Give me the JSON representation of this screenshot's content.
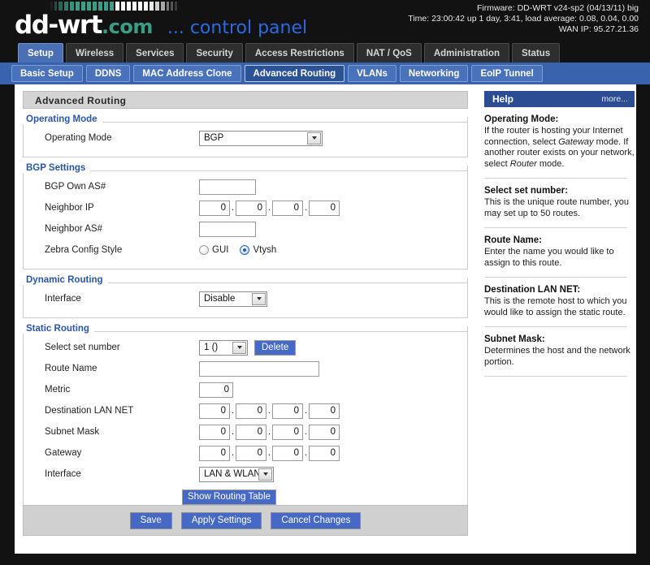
{
  "header": {
    "logo_main": "dd-wrt",
    "logo_suffix": ".com",
    "logo_tagline": "... control panel",
    "firmware": "Firmware: DD-WRT v24-sp2 (04/13/11) big",
    "time": "Time: 23:00:42 up 1 day, 3:41, load average: 0.08, 0.04, 0.00",
    "wan_ip": "WAN IP: 95.27.21.36"
  },
  "main_tabs": [
    {
      "label": "Setup",
      "active": true
    },
    {
      "label": "Wireless",
      "active": false
    },
    {
      "label": "Services",
      "active": false
    },
    {
      "label": "Security",
      "active": false
    },
    {
      "label": "Access Restrictions",
      "active": false
    },
    {
      "label": "NAT / QoS",
      "active": false
    },
    {
      "label": "Administration",
      "active": false
    },
    {
      "label": "Status",
      "active": false
    }
  ],
  "sub_tabs": [
    {
      "label": "Basic Setup",
      "active": false
    },
    {
      "label": "DDNS",
      "active": false
    },
    {
      "label": "MAC Address Clone",
      "active": false
    },
    {
      "label": "Advanced Routing",
      "active": true
    },
    {
      "label": "VLANs",
      "active": false
    },
    {
      "label": "Networking",
      "active": false
    },
    {
      "label": "EoIP Tunnel",
      "active": false
    }
  ],
  "page": {
    "title": "Advanced Routing"
  },
  "operating_mode": {
    "legend": "Operating Mode",
    "label": "Operating Mode",
    "value": "BGP"
  },
  "bgp_settings": {
    "legend": "BGP Settings",
    "own_as_label": "BGP Own AS#",
    "own_as_value": "",
    "neighbor_ip_label": "Neighbor IP",
    "neighbor_ip_octets": [
      "0",
      "0",
      "0",
      "0"
    ],
    "neighbor_as_label": "Neighbor AS#",
    "neighbor_as_value": "",
    "zebra_label": "Zebra Config Style",
    "zebra_options": [
      {
        "label": "GUI",
        "selected": false
      },
      {
        "label": "Vtysh",
        "selected": true
      }
    ]
  },
  "dynamic_routing": {
    "legend": "Dynamic Routing",
    "interface_label": "Interface",
    "interface_value": "Disable"
  },
  "static_routing": {
    "legend": "Static Routing",
    "set_number_label": "Select set number",
    "set_number_value": "1 ()",
    "delete_label": "Delete",
    "route_name_label": "Route Name",
    "route_name_value": "",
    "metric_label": "Metric",
    "metric_value": "0",
    "dest_lan_label": "Destination LAN NET",
    "dest_lan_octets": [
      "0",
      "0",
      "0",
      "0"
    ],
    "subnet_mask_label": "Subnet Mask",
    "subnet_mask_octets": [
      "0",
      "0",
      "0",
      "0"
    ],
    "gateway_label": "Gateway",
    "gateway_octets": [
      "0",
      "0",
      "0",
      "0"
    ],
    "interface_label": "Interface",
    "interface_value": "LAN & WLAN",
    "show_routing_table_label": "Show Routing Table"
  },
  "footer": {
    "save_label": "Save",
    "apply_label": "Apply Settings",
    "cancel_label": "Cancel Changes"
  },
  "help": {
    "title": "Help",
    "more_label": "more...",
    "items": [
      {
        "heading": "Operating Mode:",
        "body_1": "If the router is hosting your Internet connection, select ",
        "em_1": "Gateway",
        "body_2": " mode. If another router exists on your network, select ",
        "em_2": "Router",
        "body_3": " mode."
      },
      {
        "heading": "Select set number:",
        "body_1": "This is the unique route number, you may set up to 50 routes."
      },
      {
        "heading": "Route Name:",
        "body_1": "Enter the name you would like to assign to this route."
      },
      {
        "heading": "Destination LAN NET:",
        "body_1": "This is the remote host to which you would like to assign the static route."
      },
      {
        "heading": "Subnet Mask:",
        "body_1": "Determines the host and the network portion."
      }
    ]
  },
  "colors": {
    "accent_blue": "#4569c4",
    "tab_active": "#4a6fb5",
    "subnav_bg": "#3963ad",
    "legend_blue": "#2a56a8",
    "logo_teal": "#3a9e86",
    "page_bg": "#121212"
  }
}
